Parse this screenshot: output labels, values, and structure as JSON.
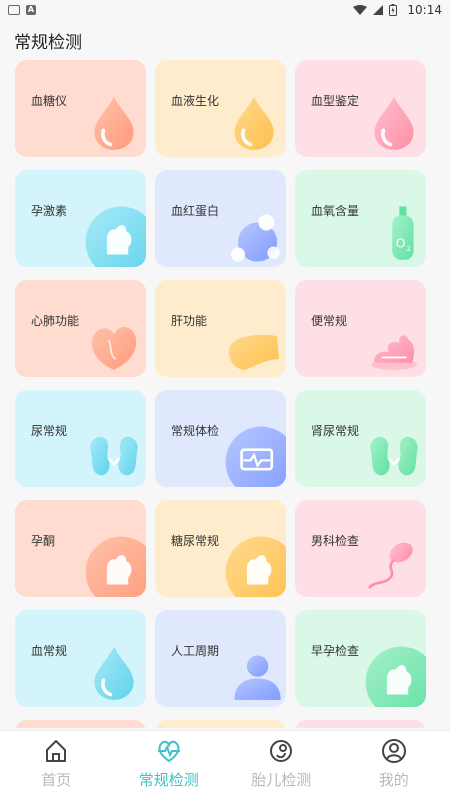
{
  "status_bar": {
    "time": "10:14"
  },
  "page": {
    "title": "常规检测"
  },
  "colors": {
    "accent": "#3fc2c9",
    "inactive": "#b9b9b9"
  },
  "cards": [
    {
      "label": "血糖仪",
      "color": "orange",
      "icon": "blood-drop-icon"
    },
    {
      "label": "血液生化",
      "color": "yellow",
      "icon": "blood-drop-icon"
    },
    {
      "label": "血型鉴定",
      "color": "pink",
      "icon": "blood-drop-icon"
    },
    {
      "label": "孕激素",
      "color": "cyan",
      "icon": "pregnant-icon"
    },
    {
      "label": "血红蛋白",
      "color": "blue",
      "icon": "molecule-icon"
    },
    {
      "label": "血氧含量",
      "color": "green",
      "icon": "oxygen-tank-icon"
    },
    {
      "label": "心肺功能",
      "color": "orange",
      "icon": "heart-icon"
    },
    {
      "label": "肝功能",
      "color": "yellow",
      "icon": "liver-icon"
    },
    {
      "label": "便常规",
      "color": "pink",
      "icon": "stool-icon"
    },
    {
      "label": "尿常规",
      "color": "cyan",
      "icon": "kidney-icon"
    },
    {
      "label": "常规体检",
      "color": "blue",
      "icon": "monitor-icon"
    },
    {
      "label": "肾尿常规",
      "color": "green",
      "icon": "kidney-icon"
    },
    {
      "label": "孕酮",
      "color": "orange",
      "icon": "pregnant-icon"
    },
    {
      "label": "糖尿常规",
      "color": "yellow",
      "icon": "pregnant-icon"
    },
    {
      "label": "男科检查",
      "color": "pink",
      "icon": "sperm-icon"
    },
    {
      "label": "血常规",
      "color": "cyan",
      "icon": "blood-drop-icon"
    },
    {
      "label": "人工周期",
      "color": "blue",
      "icon": "person-icon"
    },
    {
      "label": "早孕检查",
      "color": "green",
      "icon": "pregnant-icon"
    },
    {
      "label": "",
      "color": "orange",
      "icon": ""
    },
    {
      "label": "",
      "color": "yellow",
      "icon": ""
    },
    {
      "label": "",
      "color": "pink",
      "icon": ""
    }
  ],
  "tabs": [
    {
      "label": "首页",
      "icon": "home-icon",
      "active": false
    },
    {
      "label": "常规检测",
      "icon": "heart-pulse-icon",
      "active": true
    },
    {
      "label": "胎儿检测",
      "icon": "fetus-icon",
      "active": false
    },
    {
      "label": "我的",
      "icon": "profile-icon",
      "active": false
    }
  ]
}
